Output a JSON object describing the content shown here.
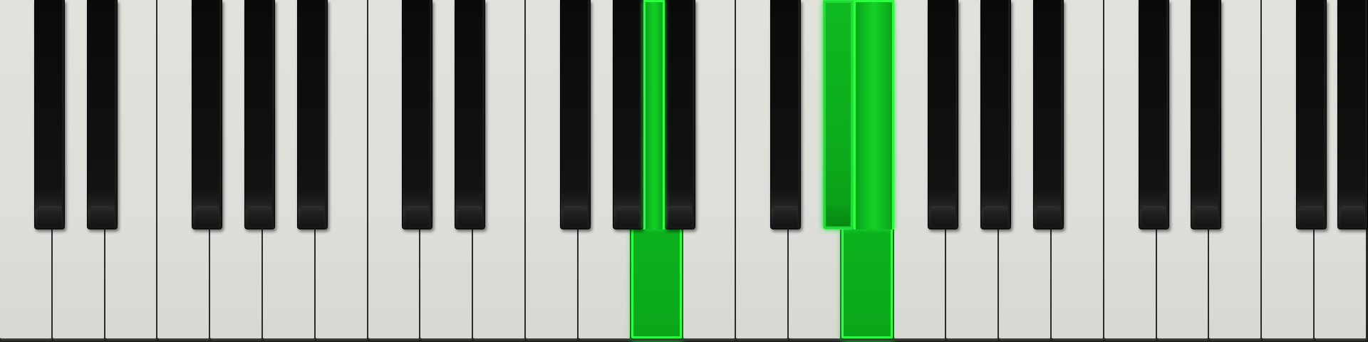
{
  "keyboard": {
    "white_key_count": 26,
    "active_color": "#10c422",
    "white_key_color": "#dededa",
    "black_key_color": "#0a0a0a",
    "active_white_keys": [
      12,
      16
    ],
    "active_black_keys": [
      15
    ],
    "black_key_after_white": [
      0,
      1,
      3,
      4,
      5,
      7,
      8,
      10,
      11,
      12,
      14,
      15,
      17,
      18,
      19,
      21,
      22,
      24,
      25
    ]
  }
}
